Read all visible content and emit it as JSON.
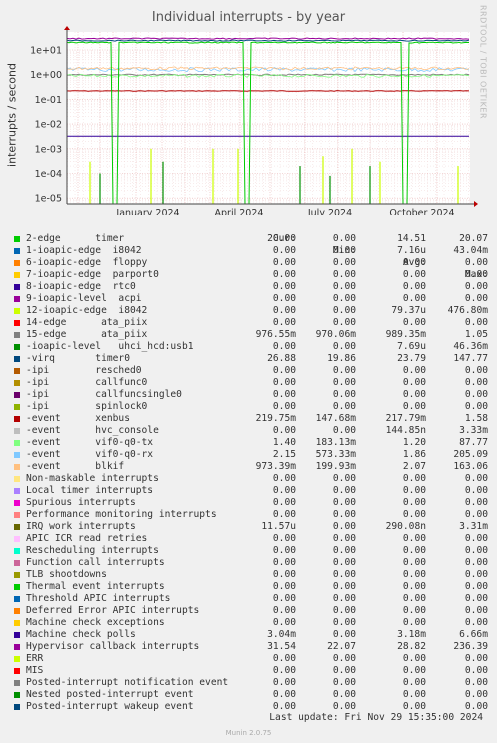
{
  "title": "Individual interrupts - by year",
  "chart_data": {
    "type": "line",
    "title": "Individual interrupts - by year",
    "ylabel": "interrupts / second",
    "yscale": "log",
    "yticks": [
      "1e+01",
      "1e+00",
      "1e-01",
      "1e-02",
      "1e-03",
      "1e-04",
      "1e-05"
    ],
    "xticks": [
      "January 2024",
      "April 2024",
      "July 2024",
      "October 2024"
    ],
    "series": [
      {
        "name": "2-edge timer",
        "approx_level": 20
      },
      {
        "name": "-virq timer0",
        "approx_level": 24
      },
      {
        "name": "Hypervisor callback interrupts",
        "approx_level": 29
      },
      {
        "name": "15-edge ata_piix",
        "approx_level": 0.99
      },
      {
        "name": "Machine check polls",
        "approx_level": 0.0032
      },
      {
        "name": "Posted-interrupt notification event",
        "approx_level": 0.22
      }
    ]
  },
  "side_text": "RRDTOOL / TOBI OETIKER",
  "legend_header": {
    "cur": "Cur:",
    "min": "Min:",
    "avg": "Avg:",
    "max": "Max:"
  },
  "legend": [
    {
      "color": "#00cc00",
      "name": "2-edge      timer",
      "cur": "20.00",
      "min": "0.00",
      "avg": "14.51",
      "max": "20.07"
    },
    {
      "color": "#0066b3",
      "name": "1-ioapic-edge  i8042",
      "cur": "0.00",
      "min": "0.00",
      "avg": "7.16u",
      "max": "43.04m"
    },
    {
      "color": "#ff8000",
      "name": "6-ioapic-edge  floppy",
      "cur": "0.00",
      "min": "0.00",
      "avg": "0.00",
      "max": "0.00"
    },
    {
      "color": "#ffcc00",
      "name": "7-ioapic-edge  parport0",
      "cur": "0.00",
      "min": "0.00",
      "avg": "0.00",
      "max": "0.00"
    },
    {
      "color": "#330099",
      "name": "8-ioapic-edge  rtc0",
      "cur": "0.00",
      "min": "0.00",
      "avg": "0.00",
      "max": "0.00"
    },
    {
      "color": "#990099",
      "name": "9-ioapic-level  acpi",
      "cur": "0.00",
      "min": "0.00",
      "avg": "0.00",
      "max": "0.00"
    },
    {
      "color": "#ccff00",
      "name": "12-ioapic-edge  i8042",
      "cur": "0.00",
      "min": "0.00",
      "avg": "79.37u",
      "max": "476.80m"
    },
    {
      "color": "#ff0000",
      "name": "14-edge      ata_piix",
      "cur": "0.00",
      "min": "0.00",
      "avg": "0.00",
      "max": "0.00"
    },
    {
      "color": "#808080",
      "name": "15-edge      ata_piix",
      "cur": "976.55m",
      "min": "970.06m",
      "avg": "989.35m",
      "max": "1.05"
    },
    {
      "color": "#008f00",
      "name": "-ioapic-level   uhci_hcd:usb1",
      "cur": "0.00",
      "min": "0.00",
      "avg": "7.69u",
      "max": "46.36m"
    },
    {
      "color": "#00487d",
      "name": "-virq       timer0",
      "cur": "26.88",
      "min": "19.86",
      "avg": "23.79",
      "max": "147.77"
    },
    {
      "color": "#b35a00",
      "name": "-ipi        resched0",
      "cur": "0.00",
      "min": "0.00",
      "avg": "0.00",
      "max": "0.00"
    },
    {
      "color": "#b38f00",
      "name": "-ipi        callfunc0",
      "cur": "0.00",
      "min": "0.00",
      "avg": "0.00",
      "max": "0.00"
    },
    {
      "color": "#6b006b",
      "name": "-ipi        callfuncsingle0",
      "cur": "0.00",
      "min": "0.00",
      "avg": "0.00",
      "max": "0.00"
    },
    {
      "color": "#8fb300",
      "name": "-ipi        spinlock0",
      "cur": "0.00",
      "min": "0.00",
      "avg": "0.00",
      "max": "0.00"
    },
    {
      "color": "#b30000",
      "name": "-event      xenbus",
      "cur": "219.75m",
      "min": "147.68m",
      "avg": "217.79m",
      "max": "1.58"
    },
    {
      "color": "#bebebe",
      "name": "-event      hvc_console",
      "cur": "0.00",
      "min": "0.00",
      "avg": "144.85n",
      "max": "3.33m"
    },
    {
      "color": "#80ff80",
      "name": "-event      vif0-q0-tx",
      "cur": "1.40",
      "min": "183.13m",
      "avg": "1.20",
      "max": "87.77"
    },
    {
      "color": "#80c9ff",
      "name": "-event      vif0-q0-rx",
      "cur": "2.15",
      "min": "573.33m",
      "avg": "1.86",
      "max": "205.09"
    },
    {
      "color": "#ffc080",
      "name": "-event      blkif",
      "cur": "973.39m",
      "min": "199.93m",
      "avg": "2.07",
      "max": "163.06"
    },
    {
      "color": "#ffe680",
      "name": "Non-maskable interrupts",
      "cur": "0.00",
      "min": "0.00",
      "avg": "0.00",
      "max": "0.00"
    },
    {
      "color": "#aa80ff",
      "name": "Local timer interrupts",
      "cur": "0.00",
      "min": "0.00",
      "avg": "0.00",
      "max": "0.00"
    },
    {
      "color": "#ee00cc",
      "name": "Spurious interrupts",
      "cur": "0.00",
      "min": "0.00",
      "avg": "0.00",
      "max": "0.00"
    },
    {
      "color": "#ff8080",
      "name": "Performance monitoring interrupts",
      "cur": "0.00",
      "min": "0.00",
      "avg": "0.00",
      "max": "0.00"
    },
    {
      "color": "#666600",
      "name": "IRQ work interrupts",
      "cur": "11.57u",
      "min": "0.00",
      "avg": "290.08n",
      "max": "3.31m"
    },
    {
      "color": "#ffbfff",
      "name": "APIC ICR read retries",
      "cur": "0.00",
      "min": "0.00",
      "avg": "0.00",
      "max": "0.00"
    },
    {
      "color": "#00ffcc",
      "name": "Rescheduling interrupts",
      "cur": "0.00",
      "min": "0.00",
      "avg": "0.00",
      "max": "0.00"
    },
    {
      "color": "#cc6699",
      "name": "Function call interrupts",
      "cur": "0.00",
      "min": "0.00",
      "avg": "0.00",
      "max": "0.00"
    },
    {
      "color": "#999900",
      "name": "TLB shootdowns",
      "cur": "0.00",
      "min": "0.00",
      "avg": "0.00",
      "max": "0.00"
    },
    {
      "color": "#00cc00",
      "name": "Thermal event interrupts",
      "cur": "0.00",
      "min": "0.00",
      "avg": "0.00",
      "max": "0.00"
    },
    {
      "color": "#0066b3",
      "name": "Threshold APIC interrupts",
      "cur": "0.00",
      "min": "0.00",
      "avg": "0.00",
      "max": "0.00"
    },
    {
      "color": "#ff8000",
      "name": "Deferred Error APIC interrupts",
      "cur": "0.00",
      "min": "0.00",
      "avg": "0.00",
      "max": "0.00"
    },
    {
      "color": "#ffcc00",
      "name": "Machine check exceptions",
      "cur": "0.00",
      "min": "0.00",
      "avg": "0.00",
      "max": "0.00"
    },
    {
      "color": "#330099",
      "name": "Machine check polls",
      "cur": "3.04m",
      "min": "0.00",
      "avg": "3.18m",
      "max": "6.66m"
    },
    {
      "color": "#990099",
      "name": "Hypervisor callback interrupts",
      "cur": "31.54",
      "min": "22.07",
      "avg": "28.82",
      "max": "236.39"
    },
    {
      "color": "#ccff00",
      "name": "ERR",
      "cur": "0.00",
      "min": "0.00",
      "avg": "0.00",
      "max": "0.00"
    },
    {
      "color": "#ff0000",
      "name": "MIS",
      "cur": "0.00",
      "min": "0.00",
      "avg": "0.00",
      "max": "0.00"
    },
    {
      "color": "#808080",
      "name": "Posted-interrupt notification event",
      "cur": "0.00",
      "min": "0.00",
      "avg": "0.00",
      "max": "0.00"
    },
    {
      "color": "#008f00",
      "name": "Nested posted-interrupt event",
      "cur": "0.00",
      "min": "0.00",
      "avg": "0.00",
      "max": "0.00"
    },
    {
      "color": "#00487d",
      "name": "Posted-interrupt wakeup event",
      "cur": "0.00",
      "min": "0.00",
      "avg": "0.00",
      "max": "0.00"
    }
  ],
  "last_update": "Last update: Fri Nov 29 15:35:00 2024",
  "footer": "Munin 2.0.75"
}
